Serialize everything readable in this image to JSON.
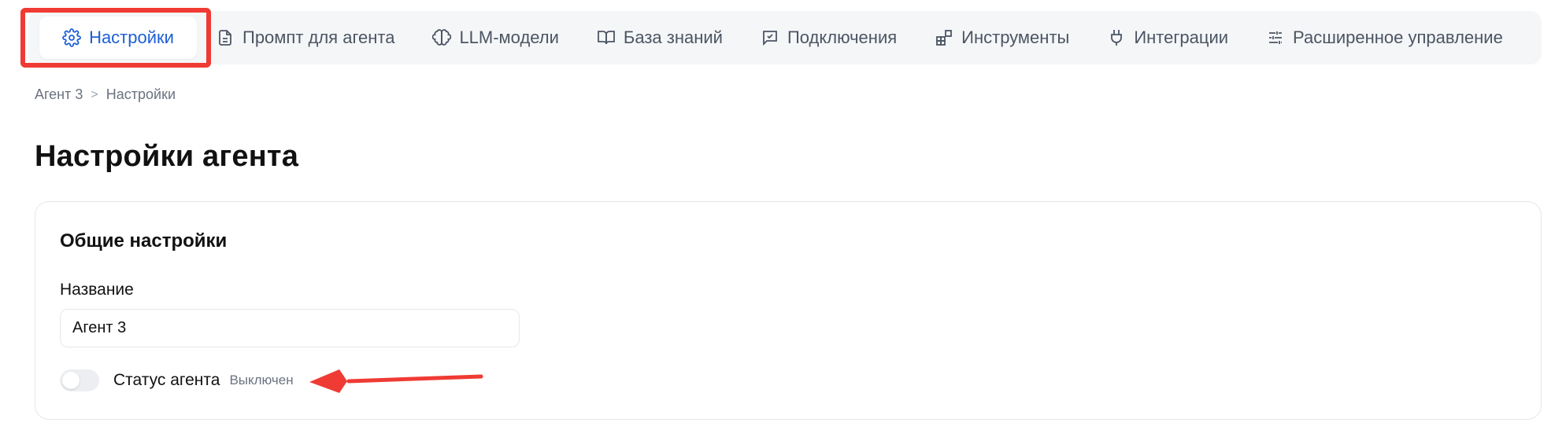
{
  "tabs": [
    {
      "label": "Настройки",
      "icon": "gear-icon",
      "active": true
    },
    {
      "label": "Промпт для агента",
      "icon": "document-icon",
      "active": false
    },
    {
      "label": "LLM-модели",
      "icon": "brain-icon",
      "active": false
    },
    {
      "label": "База знаний",
      "icon": "book-icon",
      "active": false
    },
    {
      "label": "Подключения",
      "icon": "chat-check-icon",
      "active": false
    },
    {
      "label": "Инструменты",
      "icon": "blocks-icon",
      "active": false
    },
    {
      "label": "Интеграции",
      "icon": "plug-icon",
      "active": false
    },
    {
      "label": "Расширенное управление",
      "icon": "sliders-icon",
      "active": false
    }
  ],
  "breadcrumb": {
    "items": [
      "Агент 3",
      "Настройки"
    ],
    "separator": ">"
  },
  "page_title": "Настройки агента",
  "general_settings": {
    "title": "Общие настройки",
    "name_label": "Название",
    "name_value": "Агент 3",
    "status_label": "Статус агента",
    "status_value": "Выключен",
    "status_enabled": false
  },
  "colors": {
    "accent": "#1d5fd6",
    "annotation_red": "#ef3b34",
    "tabs_background": "#f5f6f8"
  }
}
